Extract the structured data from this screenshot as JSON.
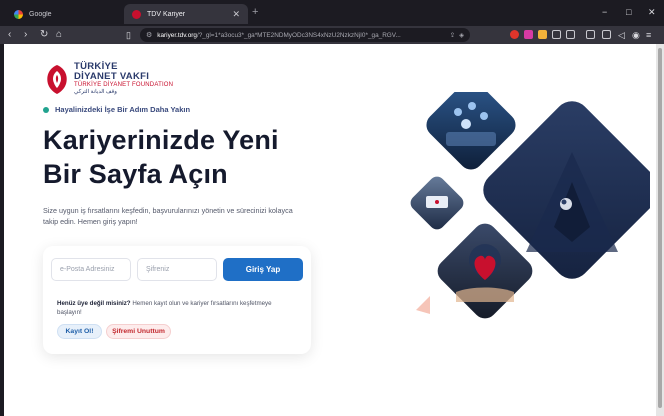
{
  "browser": {
    "tabs": [
      {
        "label": "Google",
        "active": false
      },
      {
        "label": "TDV Kariyer",
        "active": true
      }
    ],
    "new_tab": "+",
    "window_controls": [
      "−",
      "□",
      "✕"
    ],
    "nav_buttons": [
      "‹",
      "›",
      "↻",
      "⌂"
    ],
    "url_host": "kariyer.tdv.org",
    "url_rest": "/?_gl=1*a3ocu3*_ga*MTE2NDMyODc3NS4xNzU2NzkzNjI0*_ga_RGV...",
    "colors": {
      "tabbar": "#1c1b22",
      "toolbar": "#35343d"
    }
  },
  "logo": {
    "line1": "TÜRKİYE",
    "line1b": "DİYANET VAKFI",
    "line2": "TÜRKİYE DİYANET FOUNDATION",
    "line3": "وقف الديانة التركي"
  },
  "hero": {
    "tagline": "Hayalinizdeki İşe Bir Adım Daha Yakın",
    "title_line1": "Kariyerinizde Yeni",
    "title_line2": "Bir Sayfa Açın",
    "description": "Size uygun iş fırsatlarını keşfedin, başvurularınızı yönetin ve sürecinizi kolayca takip edin. Hemen giriş yapın!"
  },
  "login": {
    "email_placeholder": "e-Posta Adresiniz",
    "password_placeholder": "Şifreniz",
    "login_button": "Giriş Yap",
    "register_question": "Henüz üye değil misiniz?",
    "register_text": "Hemen kayıt olun ve kariyer fırsatlarını keşfetmeye başlayın!",
    "register_button": "Kayıt Ol!",
    "forgot_button": "Şifremi Unuttum"
  },
  "colors": {
    "brand_navy": "#2a3a6b",
    "brand_red": "#c8102e",
    "accent_blue": "#1f6fc6",
    "accent_teal": "#21a38f"
  }
}
